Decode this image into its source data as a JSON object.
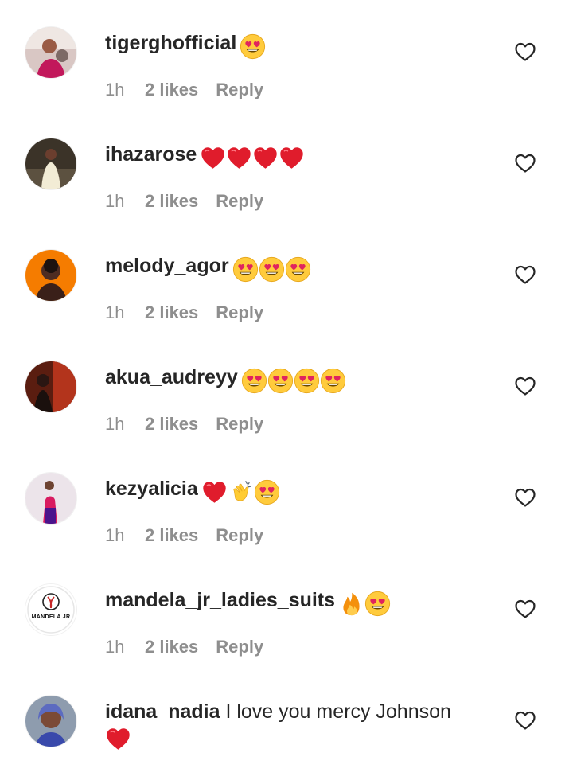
{
  "comments": [
    {
      "username": "tigerghofficial",
      "text": "",
      "emojis": [
        "heart-eyes"
      ],
      "time": "1h",
      "likes": "2 likes",
      "reply": "Reply",
      "avatar": "avatar-photo"
    },
    {
      "username": "ihazarose",
      "text": "",
      "emojis": [
        "red-heart",
        "red-heart",
        "red-heart",
        "red-heart"
      ],
      "time": "1h",
      "likes": "2 likes",
      "reply": "Reply",
      "avatar": "avatar-photo"
    },
    {
      "username": "melody_agor",
      "text": "",
      "emojis": [
        "heart-eyes",
        "heart-eyes",
        "heart-eyes"
      ],
      "time": "1h",
      "likes": "2 likes",
      "reply": "Reply",
      "avatar": "avatar-photo"
    },
    {
      "username": "akua_audreyy",
      "text": "",
      "emojis": [
        "heart-eyes",
        "heart-eyes",
        "heart-eyes",
        "heart-eyes"
      ],
      "time": "1h",
      "likes": "2 likes",
      "reply": "Reply",
      "avatar": "avatar-photo"
    },
    {
      "username": "kezyalicia",
      "text": "",
      "emojis": [
        "red-heart",
        "clapping-hands",
        "heart-eyes"
      ],
      "time": "1h",
      "likes": "2 likes",
      "reply": "Reply",
      "avatar": "avatar-photo"
    },
    {
      "username": "mandela_jr_ladies_suits",
      "text": "",
      "emojis": [
        "fire",
        "heart-eyes"
      ],
      "time": "1h",
      "likes": "2 likes",
      "reply": "Reply",
      "avatar": "avatar-logo",
      "logo_text": "MANDELA JR"
    },
    {
      "username": "idana_nadia",
      "text": "I love you mercy Johnson",
      "emojis": [
        "red-heart"
      ],
      "avatar": "avatar-photo"
    }
  ],
  "colors": {
    "username": "#262626",
    "meta": "#8e8e8e",
    "heart_red": "#e01c2c",
    "emoji_yellow": "#ffcc33"
  },
  "icons": {
    "like": "heart-outline-icon"
  }
}
